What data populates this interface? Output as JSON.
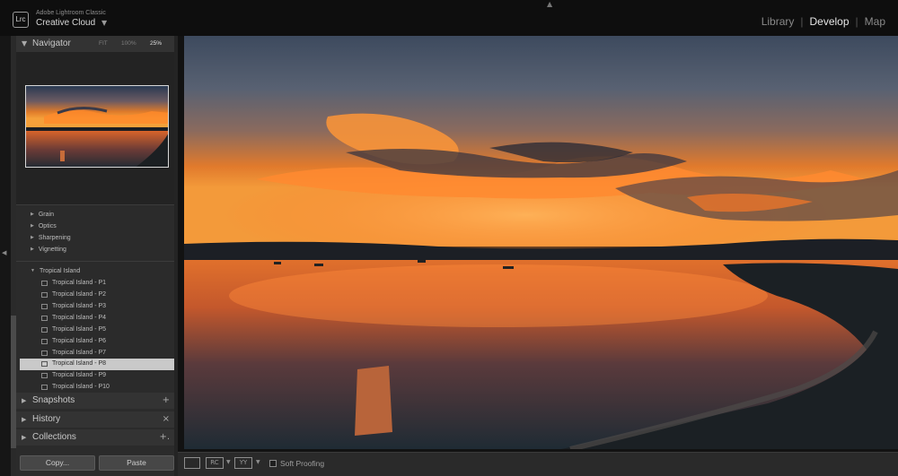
{
  "app": {
    "logo": "Lrc",
    "brand_small": "Adobe Lightroom Classic",
    "brand_large": "Creative Cloud"
  },
  "modules": [
    "Library",
    "Develop",
    "Map"
  ],
  "active_module": "Develop",
  "navigator": {
    "title": "Navigator",
    "zoom_options": [
      "FIT",
      "100%",
      "25%"
    ],
    "selected_zoom": "25%"
  },
  "detail_sections": [
    "Grain",
    "Optics",
    "Sharpening",
    "Vignetting"
  ],
  "preset_group": {
    "name": "Tropical Island",
    "presets": [
      "Tropical Island - P1",
      "Tropical Island - P2",
      "Tropical Island - P3",
      "Tropical Island - P4",
      "Tropical Island - P5",
      "Tropical Island - P6",
      "Tropical Island - P7",
      "Tropical Island - P8",
      "Tropical Island - P9",
      "Tropical Island - P10"
    ],
    "selected": "Tropical Island - P8"
  },
  "panels": {
    "snapshots": {
      "label": "Snapshots",
      "action": "+"
    },
    "history": {
      "label": "History",
      "action": "×"
    },
    "collections": {
      "label": "Collections",
      "action": "+."
    }
  },
  "buttons": {
    "copy": "Copy...",
    "paste": "Paste"
  },
  "toolbar": {
    "soft_proofing": "Soft Proofing",
    "compare_yy": "YY",
    "compare_rc": "RC"
  },
  "colors": {
    "accent_text": "#e6e6e6",
    "panel_bg": "#2b2b2b",
    "selected_row": "#c9c9c9"
  },
  "icons": [
    "collapse-triangle-icon",
    "expand-triangle-icon",
    "preset-icon",
    "left-panel-toggle-icon",
    "loupe-view-icon",
    "before-after-icon"
  ]
}
